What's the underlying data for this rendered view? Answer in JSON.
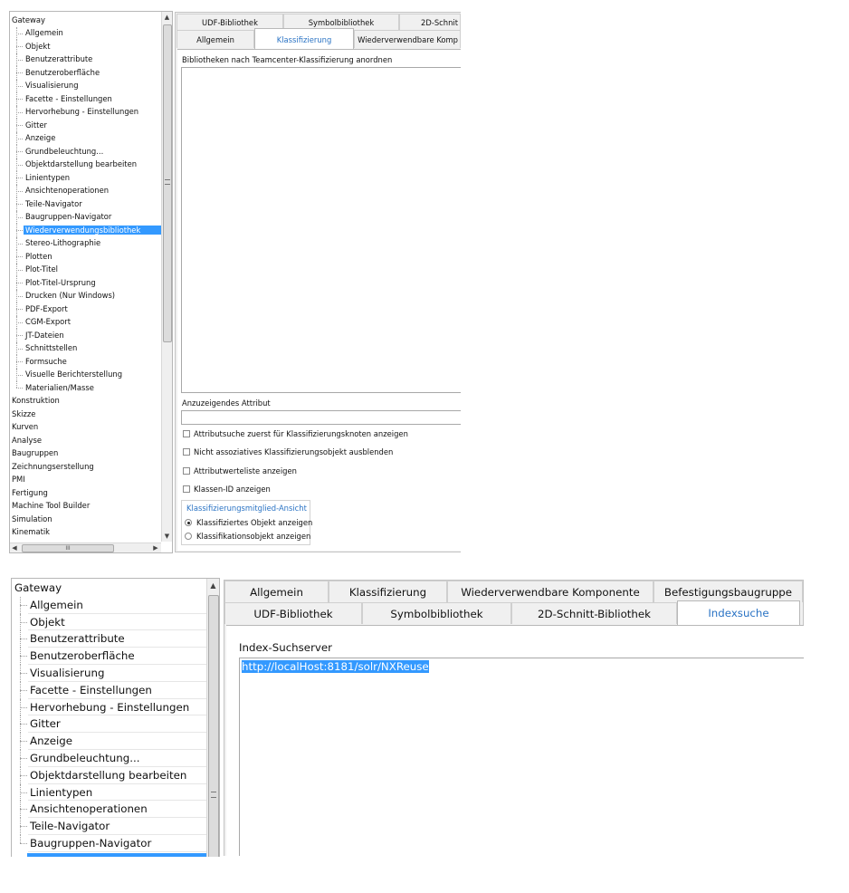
{
  "top": {
    "tree": {
      "root": "Gateway",
      "children": [
        "Allgemein",
        "Objekt",
        "Benutzerattribute",
        "Benutzeroberfläche",
        "Visualisierung",
        "Facette - Einstellungen",
        "Hervorhebung - Einstellungen",
        "Gitter",
        "Anzeige",
        "Grundbeleuchtung...",
        "Objektdarstellung bearbeiten",
        "Linientypen",
        "Ansichtenoperationen",
        "Teile-Navigator",
        "Baugruppen-Navigator",
        "Wiederverwendungsbibliothek",
        "Stereo-Lithographie",
        "Plotten",
        "Plot-Titel",
        "Plot-Titel-Ursprung",
        "Drucken (Nur Windows)",
        "PDF-Export",
        "CGM-Export",
        "JT-Dateien",
        "Schnittstellen",
        "Formsuche",
        "Visuelle Berichterstellung",
        "Materialien/Masse"
      ],
      "selected": "Wiederverwendungsbibliothek",
      "roots_after": [
        "Konstruktion",
        "Skizze",
        "Kurven",
        "Analyse",
        "Baugruppen",
        "Zeichnungserstellung",
        "PMI",
        "Fertigung",
        "Machine Tool Builder",
        "Simulation",
        "Kinematik"
      ],
      "hscroll_grip": "III"
    },
    "tabs_row1": [
      "UDF-Bibliothek",
      "Symbolbibliothek",
      "2D-Schnit"
    ],
    "tabs_row2": [
      "Allgemein",
      "Klassifizierung",
      "Wiederverwendbare Komp"
    ],
    "active_tab": "Klassifizierung",
    "section_label": "Bibliotheken nach Teamcenter-Klassifizierung anordnen",
    "attribute_label": "Anzuzeigendes Attribut",
    "attribute_value": "",
    "checkboxes": [
      {
        "label": "Attributsuche zuerst für Klassifizierungsknoten anzeigen",
        "checked": false
      },
      {
        "label": "Nicht assoziatives Klassifizierungsobjekt ausblenden",
        "checked": false
      },
      {
        "label": "Attributwerteliste anzeigen",
        "checked": false
      },
      {
        "label": "Klassen-ID anzeigen",
        "checked": false
      }
    ],
    "group_title": "Klassifizierungsmitglied-Ansicht",
    "radios": [
      {
        "label": "Klassifiziertes Objekt anzeigen",
        "checked": true
      },
      {
        "label": "Klassifikationsobjekt anzeigen",
        "checked": false
      }
    ]
  },
  "bottom": {
    "tree": {
      "root": "Gateway",
      "children": [
        "Allgemein",
        "Objekt",
        "Benutzerattribute",
        "Benutzeroberfläche",
        "Visualisierung",
        "Facette - Einstellungen",
        "Hervorhebung - Einstellungen",
        "Gitter",
        "Anzeige",
        "Grundbeleuchtung...",
        "Objektdarstellung bearbeiten",
        "Linientypen",
        "Ansichtenoperationen",
        "Teile-Navigator",
        "Baugruppen-Navigator"
      ]
    },
    "tabs_row1": [
      "Allgemein",
      "Klassifizierung",
      "Wiederverwendbare Komponente",
      "Befestigungsbaugruppe"
    ],
    "tabs_row2": [
      "UDF-Bibliothek",
      "Symbolbibliothek",
      "2D-Schnitt-Bibliothek",
      "Indexsuche"
    ],
    "active_tab": "Indexsuche",
    "field_label": "Index-Suchserver",
    "field_value": "http://localHost:8181/solr/NXReuse"
  },
  "colors": {
    "selection": "#3399ff",
    "active_tab_text": "#2a73c4",
    "group_title": "#2a73c4"
  },
  "icons": {
    "scroll_up": "triangle-up",
    "scroll_down": "triangle-down",
    "scroll_left": "triangle-left",
    "scroll_right": "triangle-right",
    "scroll_grip": "grip-lines"
  }
}
